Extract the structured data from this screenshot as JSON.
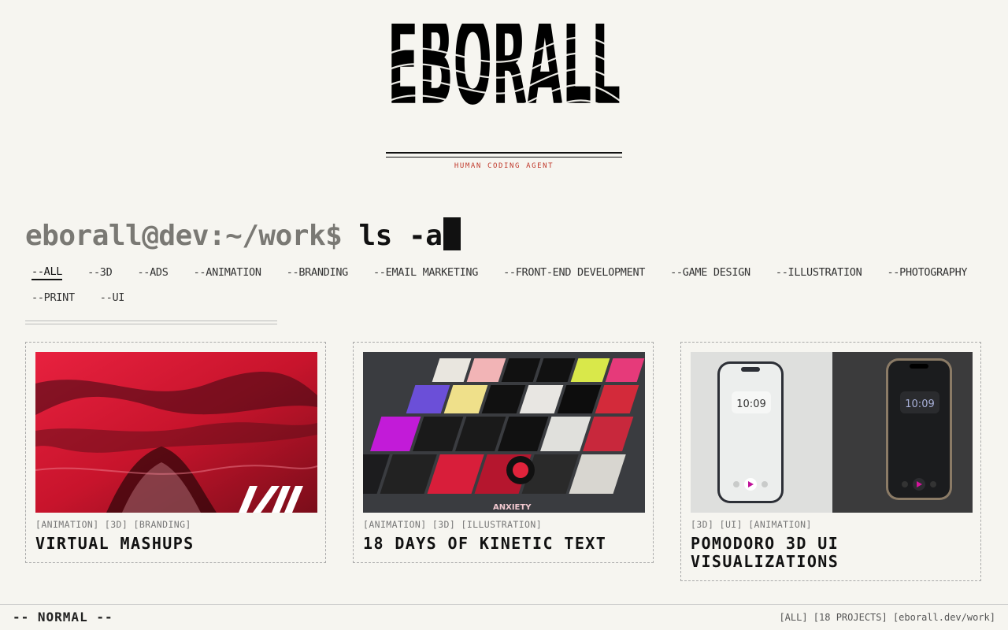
{
  "logo": {
    "text": "EBORALL",
    "tagline": "HUMAN CODING AGENT"
  },
  "prompt": {
    "user": "eborall@dev:~/work$",
    "command": "ls -a"
  },
  "filters": [
    {
      "label": "--ALL",
      "active": true
    },
    {
      "label": "--3D"
    },
    {
      "label": "--ADS"
    },
    {
      "label": "--ANIMATION"
    },
    {
      "label": "--BRANDING"
    },
    {
      "label": "--EMAIL MARKETING"
    },
    {
      "label": "--FRONT-END DEVELOPMENT"
    },
    {
      "label": "--GAME DESIGN"
    },
    {
      "label": "--ILLUSTRATION"
    },
    {
      "label": "--PHOTOGRAPHY"
    },
    {
      "label": "--PRINT"
    },
    {
      "label": "--UI"
    }
  ],
  "projects": [
    {
      "tags": "[ANIMATION] [3D] [BRANDING]",
      "title": "VIRTUAL MASHUPS",
      "thumb": {
        "kind": "red-abstract",
        "mark": "VM"
      }
    },
    {
      "tags": "[ANIMATION] [3D] [ILLUSTRATION]",
      "title": "18 DAYS OF KINETIC TEXT",
      "thumb": {
        "kind": "poster-grid",
        "visible_text": "ANXIETY"
      }
    },
    {
      "tags": "[3D] [UI] [ANIMATION]",
      "title": "POMODORO 3D UI VISUALIZATIONS",
      "thumb": {
        "kind": "phones",
        "time": "10:09"
      }
    }
  ],
  "statusbar": {
    "mode": "-- NORMAL --",
    "info": "[ALL] [18 PROJECTS] [eborall.dev/work]"
  },
  "colors": {
    "background": "#f6f5f0",
    "accent": "#c0392b",
    "text": "#111111"
  }
}
